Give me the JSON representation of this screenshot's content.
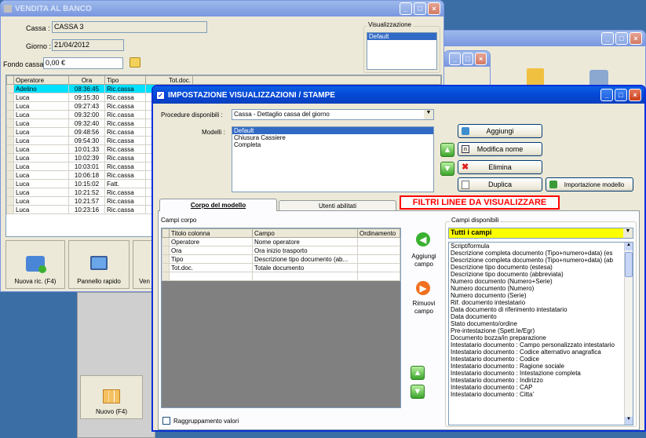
{
  "back_window": {
    "title": ""
  },
  "vendita": {
    "title": "VENDITA AL BANCO",
    "cassa_label": "Cassa :",
    "cassa_value": "CASSA 3",
    "giorno_label": "Giorno :",
    "giorno_value": "21/04/2012",
    "fondo_label": "Fondo cassa :",
    "fondo_value": "0,00 €",
    "visualizzazione_label": "Visualizzazione",
    "visualizzazione_items": [
      "Default"
    ],
    "grid_headers": [
      "Operatore",
      "Ora",
      "Tipo",
      "Tot.doc."
    ],
    "rows": [
      [
        "Adelino",
        "08:36:45",
        "Ric.cassa"
      ],
      [
        "Luca",
        "09:15:30",
        "Ric.cassa"
      ],
      [
        "Luca",
        "09:27:43",
        "Ric.cassa"
      ],
      [
        "Luca",
        "09:32:00",
        "Ric.cassa"
      ],
      [
        "Luca",
        "09:32:40",
        "Ric.cassa"
      ],
      [
        "Luca",
        "09:48:56",
        "Ric.cassa"
      ],
      [
        "Luca",
        "09:54:30",
        "Ric.cassa"
      ],
      [
        "Luca",
        "10:01:33",
        "Ric.cassa"
      ],
      [
        "Luca",
        "10:02:39",
        "Ric.cassa"
      ],
      [
        "Luca",
        "10:03:01",
        "Ric.cassa"
      ],
      [
        "Luca",
        "10:06:18",
        "Ric.cassa"
      ],
      [
        "Luca",
        "10:15:02",
        "Fatt."
      ],
      [
        "Luca",
        "10:21:52",
        "Ric.cassa"
      ],
      [
        "Luca",
        "10:21:57",
        "Ric.cassa"
      ],
      [
        "Luca",
        "10:23:16",
        "Ric.cassa"
      ]
    ],
    "btn_nuova_ric": "Nuova ric. (F4)",
    "btn_pannello": "Pannello rapido",
    "btn_ven": "Ven"
  },
  "nuovo_btn": "Nuovo (F4)",
  "dialog": {
    "title": "IMPOSTAZIONE VISUALIZZAZIONI / STAMPE",
    "procedure_label": "Procedure disponibili :",
    "procedure_value": "Cassa - Dettaglio cassa del giorno",
    "modelli_label": "Modelli :",
    "modelli": [
      "Default",
      "Chiusura Cassiere",
      "Completa"
    ],
    "btn_aggiungi": "Aggiungi",
    "btn_modifica": "Modifica nome",
    "btn_elimina": "Elimina",
    "btn_duplica": "Duplica",
    "btn_importazione": "Importazione modello",
    "tab_corpo": "Corpo del modello",
    "tab_utenti": "Utenti abilitati",
    "filtri_label": "FILTRI LINEE DA VISUALIZZARE",
    "campi_corpo_label": "Campi corpo",
    "corpo_headers": [
      "Titolo colonna",
      "Campo",
      "Ordinamento"
    ],
    "corpo_rows": [
      [
        "Operatore",
        "Nome operatore",
        ""
      ],
      [
        "Ora",
        "Ora inizio trasporto",
        ""
      ],
      [
        "Tipo",
        "Descrizione tipo documento (ab...",
        ""
      ],
      [
        "Tot.doc.",
        "Totale documento",
        ""
      ]
    ],
    "aggiungi_campo": "Aggiungi campo",
    "rimuovi_campo": "Rimuovi campo",
    "raggruppamento": "Raggruppamento valori",
    "campi_disponibili_label": "Campi disponibili",
    "campi_filter_value": "Tutti i campi",
    "campi_disponibili": [
      "Script/formula",
      "Descrizione completa documento (Tipo+numero+data) (es",
      "Descrizione completa documento (Tipo+numero+data) (ab",
      "Descrizione tipo documento (estesa)",
      "Descrizione tipo documento (abbreviata)",
      "Numero documento (Numero+Serie)",
      "Numero documento (Numero)",
      "Numero documento (Serie)",
      "Rif. documento intestatario",
      "Data documento di riferimento intestatario",
      "Data documento",
      "Stato documento/ordine",
      "Pre-intestazione (Spett.le/Egr)",
      "Documento bozza/in preparazione",
      "Intestatario documento : Campo personalizzato intestatario",
      "Intestatario documento : Codice alternativo anagrafica",
      "Intestatario documento : Codice",
      "Intestatario documento : Ragione sociale",
      "Intestatario documento : Intestazione completa",
      "Intestatario documento : Indirizzo",
      "Intestatario documento : CAP",
      "Intestatario documento : Citta'"
    ]
  },
  "colors": {
    "accent": "#0a5fe4",
    "filtri_red": "#ff0000",
    "selected_row": "#00e0ff",
    "campi_filter_bg": "#ffff00"
  }
}
